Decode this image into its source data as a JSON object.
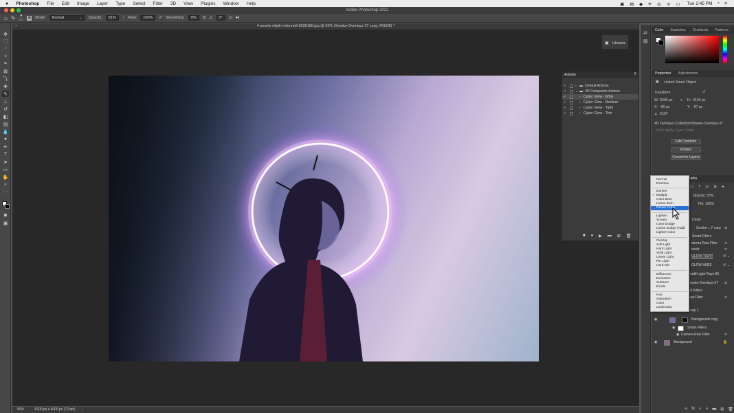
{
  "menubar": {
    "apple": "",
    "app": "Photoshop",
    "items": [
      "File",
      "Edit",
      "Image",
      "Layer",
      "Type",
      "Select",
      "Filter",
      "3D",
      "View",
      "Plugins",
      "Window",
      "Help"
    ],
    "clock": "Tue 2:45 PM"
  },
  "window": {
    "title": "Adobe Photoshop 2022"
  },
  "options": {
    "brush_size": "277",
    "mode_label": "Mode:",
    "mode_value": "Normal",
    "opacity_label": "Opacity:",
    "opacity_value": "81%",
    "flow_label": "Flow:",
    "flow_value": "100%",
    "smoothing_label": "Smoothing:",
    "smoothing_value": "0%",
    "angle_value": "0°"
  },
  "document": {
    "tab_title": "4 pexels-elijah-o'donnell-8935186.jpg @ 50% (Smoke-Overlays-37 copy, RGB/8) *",
    "zoom": "50%",
    "doc_size": "6000 px x 4000 px (72 ppi)"
  },
  "libraries": {
    "label": "Libraries"
  },
  "actions_panel": {
    "title": "Actions",
    "rows": [
      {
        "label": "Default Actions",
        "level": 0,
        "selected": false
      },
      {
        "label": "4D Composite Actions",
        "level": 0,
        "selected": false
      },
      {
        "label": "Cyber Glow - Wide",
        "level": 1,
        "selected": true
      },
      {
        "label": "Cyber Glow - Medium",
        "level": 1,
        "selected": false
      },
      {
        "label": "Cyber Glow - Tight",
        "level": 1,
        "selected": false
      },
      {
        "label": "Cyber Glow - Thin",
        "level": 1,
        "selected": false
      }
    ]
  },
  "color_panel": {
    "tabs": [
      "Color",
      "Swatches",
      "Gradients",
      "Patterns"
    ],
    "accent": "#ff0000"
  },
  "properties": {
    "tabs": [
      "Properties",
      "Adjustments"
    ],
    "object_type": "Linked Smart Object",
    "transform_label": "Transform",
    "w_label": "W:",
    "w_value": "6000 px",
    "h_label": "H:",
    "h_value": "4134 px",
    "x_label": "X:",
    "x_value": "-60 px",
    "y_label": "Y:",
    "y_value": "-67 px",
    "angle_value": "0.00°",
    "source_path": "4D Overlays Collection/Smoke-Overlays-37",
    "comps_placeholder": "Don't Apply Layer Comp",
    "buttons": [
      "Edit Contents",
      "Embed",
      "Convert to Layers"
    ]
  },
  "layers_panel": {
    "tab_partial": "Paths",
    "opacity_label": "Opacity:",
    "opacity_value": "37%",
    "fill_label": "Fill:",
    "fill_value": "100%",
    "rows": [
      {
        "label": "Circle"
      },
      {
        "label": "Smoke-...7 copy"
      },
      {
        "label": "Smart Filters"
      },
      {
        "label": "amera Raw Filter"
      },
      {
        "label": "evels"
      },
      {
        "label": "GLOW TIGHT"
      },
      {
        "label": "GLOW WIDE"
      },
      {
        "label": "ordil-Light-Rays-66"
      },
      {
        "label": "moke-Overlays-37"
      },
      {
        "label": "rt Filters"
      },
      {
        "label": "aw Filter"
      },
      {
        "label": "oup 1"
      },
      {
        "label": "Background copy"
      },
      {
        "label": "Smart Filters"
      },
      {
        "label": "Camera Raw Filter"
      },
      {
        "label": "Background"
      }
    ]
  },
  "blend_menu": {
    "groups": [
      [
        "Normal",
        "Dissolve"
      ],
      [
        "Darken",
        "Multiply",
        "Color Burn",
        "Linear Burn",
        "Darker Color"
      ],
      [
        "Lighten",
        "Screen",
        "Color Dodge",
        "Linear Dodge (Add)",
        "Lighter Color"
      ],
      [
        "Overlay",
        "Soft Light",
        "Hard Light",
        "Vivid Light",
        "Linear Light",
        "Pin Light",
        "Hard Mix"
      ],
      [
        "Difference",
        "Exclusion",
        "Subtract",
        "Divide"
      ],
      [
        "Hue",
        "Saturation",
        "Color",
        "Luminosity"
      ]
    ],
    "checked": "Multiply",
    "highlighted": "Darker Color"
  }
}
